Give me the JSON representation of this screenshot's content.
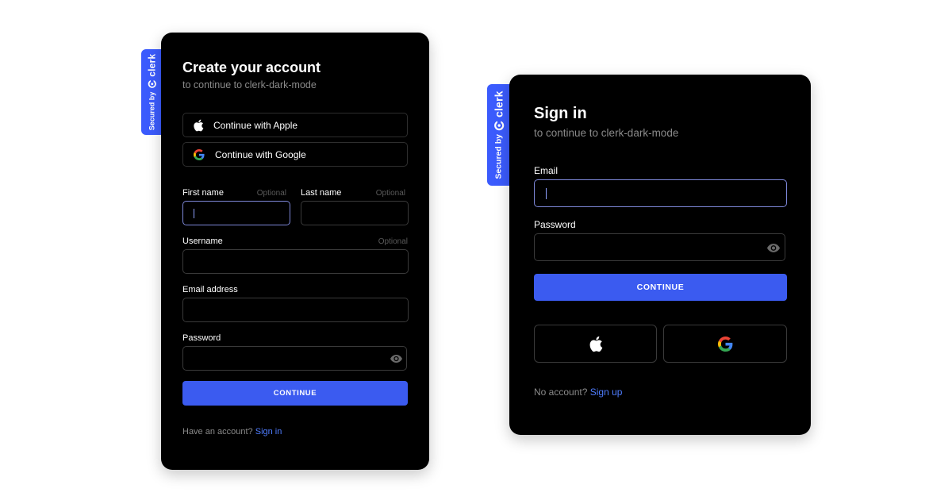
{
  "badge": {
    "secured_by": "Secured by",
    "brand": "clerk"
  },
  "signup": {
    "title": "Create your account",
    "subtitle": "to continue to clerk-dark-mode",
    "apple_label": "Continue with Apple",
    "google_label": "Continue with Google",
    "first_name_label": "First name",
    "first_name_optional": "Optional",
    "last_name_label": "Last name",
    "last_name_optional": "Optional",
    "username_label": "Username",
    "username_optional": "Optional",
    "email_label": "Email address",
    "password_label": "Password",
    "continue_label": "CONTINUE",
    "footer_text": "Have an account?",
    "footer_link": "Sign in"
  },
  "signin": {
    "title": "Sign in",
    "subtitle": "to continue to clerk-dark-mode",
    "email_label": "Email",
    "password_label": "Password",
    "continue_label": "CONTINUE",
    "footer_text": "No account?",
    "footer_link": "Sign up"
  },
  "icons": {
    "apple": "apple-icon",
    "google": "google-icon",
    "eye": "eye-icon",
    "clerk": "clerk-logo-icon"
  },
  "colors": {
    "accent": "#3b5bf0",
    "badge": "#3b5bfd",
    "link": "#4f7dff",
    "card": "#000000",
    "focus_border": "#7d87d8"
  }
}
